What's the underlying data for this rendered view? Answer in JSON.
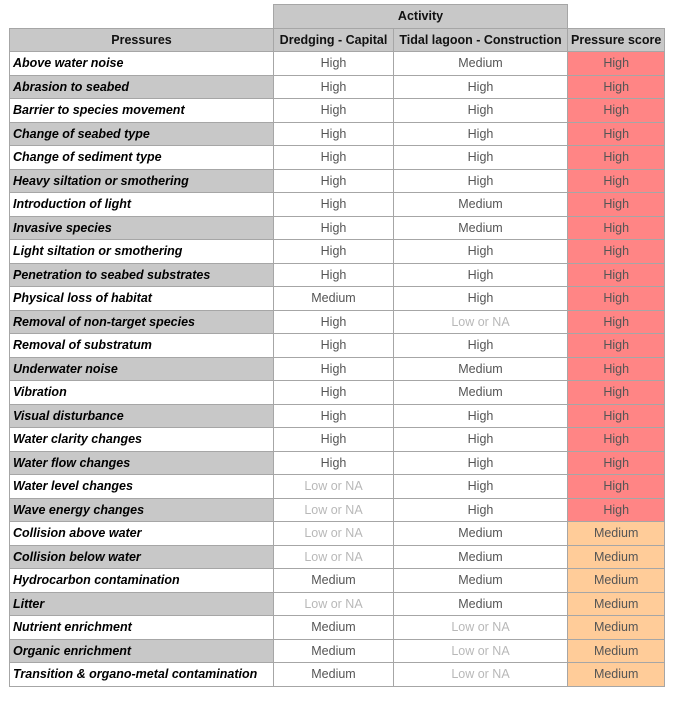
{
  "table": {
    "group_header": "Activity",
    "headers": {
      "pressures": "Pressures",
      "activity_1": "Dredging - Capital",
      "activity_2": "Tidal lagoon - Construction",
      "score": "Pressure score"
    },
    "colors": {
      "High": "#ff8585",
      "Medium": "#ffcc99",
      "header_bg": "#c8c8c8"
    },
    "rows": [
      {
        "pressure": "Above water noise",
        "a1": "High",
        "a2": "Medium",
        "score": "High"
      },
      {
        "pressure": "Abrasion to seabed",
        "a1": "High",
        "a2": "High",
        "score": "High"
      },
      {
        "pressure": "Barrier to species movement",
        "a1": "High",
        "a2": "High",
        "score": "High"
      },
      {
        "pressure": "Change of seabed type",
        "a1": "High",
        "a2": "High",
        "score": "High"
      },
      {
        "pressure": "Change of sediment type",
        "a1": "High",
        "a2": "High",
        "score": "High"
      },
      {
        "pressure": "Heavy siltation or smothering",
        "a1": "High",
        "a2": "High",
        "score": "High"
      },
      {
        "pressure": "Introduction of light",
        "a1": "High",
        "a2": "Medium",
        "score": "High"
      },
      {
        "pressure": "Invasive species",
        "a1": "High",
        "a2": "Medium",
        "score": "High"
      },
      {
        "pressure": "Light siltation or smothering",
        "a1": "High",
        "a2": "High",
        "score": "High"
      },
      {
        "pressure": "Penetration to seabed substrates",
        "a1": "High",
        "a2": "High",
        "score": "High"
      },
      {
        "pressure": "Physical loss of habitat",
        "a1": "Medium",
        "a2": "High",
        "score": "High"
      },
      {
        "pressure": "Removal of non-target species",
        "a1": "High",
        "a2": "Low or NA",
        "score": "High"
      },
      {
        "pressure": "Removal of substratum",
        "a1": "High",
        "a2": "High",
        "score": "High"
      },
      {
        "pressure": "Underwater noise",
        "a1": "High",
        "a2": "Medium",
        "score": "High"
      },
      {
        "pressure": "Vibration",
        "a1": "High",
        "a2": "Medium",
        "score": "High"
      },
      {
        "pressure": "Visual disturbance",
        "a1": "High",
        "a2": "High",
        "score": "High"
      },
      {
        "pressure": "Water clarity changes",
        "a1": "High",
        "a2": "High",
        "score": "High"
      },
      {
        "pressure": "Water flow changes",
        "a1": "High",
        "a2": "High",
        "score": "High"
      },
      {
        "pressure": "Water level changes",
        "a1": "Low or NA",
        "a2": "High",
        "score": "High"
      },
      {
        "pressure": "Wave energy changes",
        "a1": "Low or NA",
        "a2": "High",
        "score": "High"
      },
      {
        "pressure": "Collision above water",
        "a1": "Low or NA",
        "a2": "Medium",
        "score": "Medium"
      },
      {
        "pressure": "Collision below water",
        "a1": "Low or NA",
        "a2": "Medium",
        "score": "Medium"
      },
      {
        "pressure": "Hydrocarbon contamination",
        "a1": "Medium",
        "a2": "Medium",
        "score": "Medium"
      },
      {
        "pressure": "Litter",
        "a1": "Low or NA",
        "a2": "Medium",
        "score": "Medium"
      },
      {
        "pressure": "Nutrient enrichment",
        "a1": "Medium",
        "a2": "Low or NA",
        "score": "Medium"
      },
      {
        "pressure": "Organic enrichment",
        "a1": "Medium",
        "a2": "Low or NA",
        "score": "Medium"
      },
      {
        "pressure": "Transition & organo-metal contamination",
        "a1": "Medium",
        "a2": "Low or NA",
        "score": "Medium"
      }
    ]
  }
}
